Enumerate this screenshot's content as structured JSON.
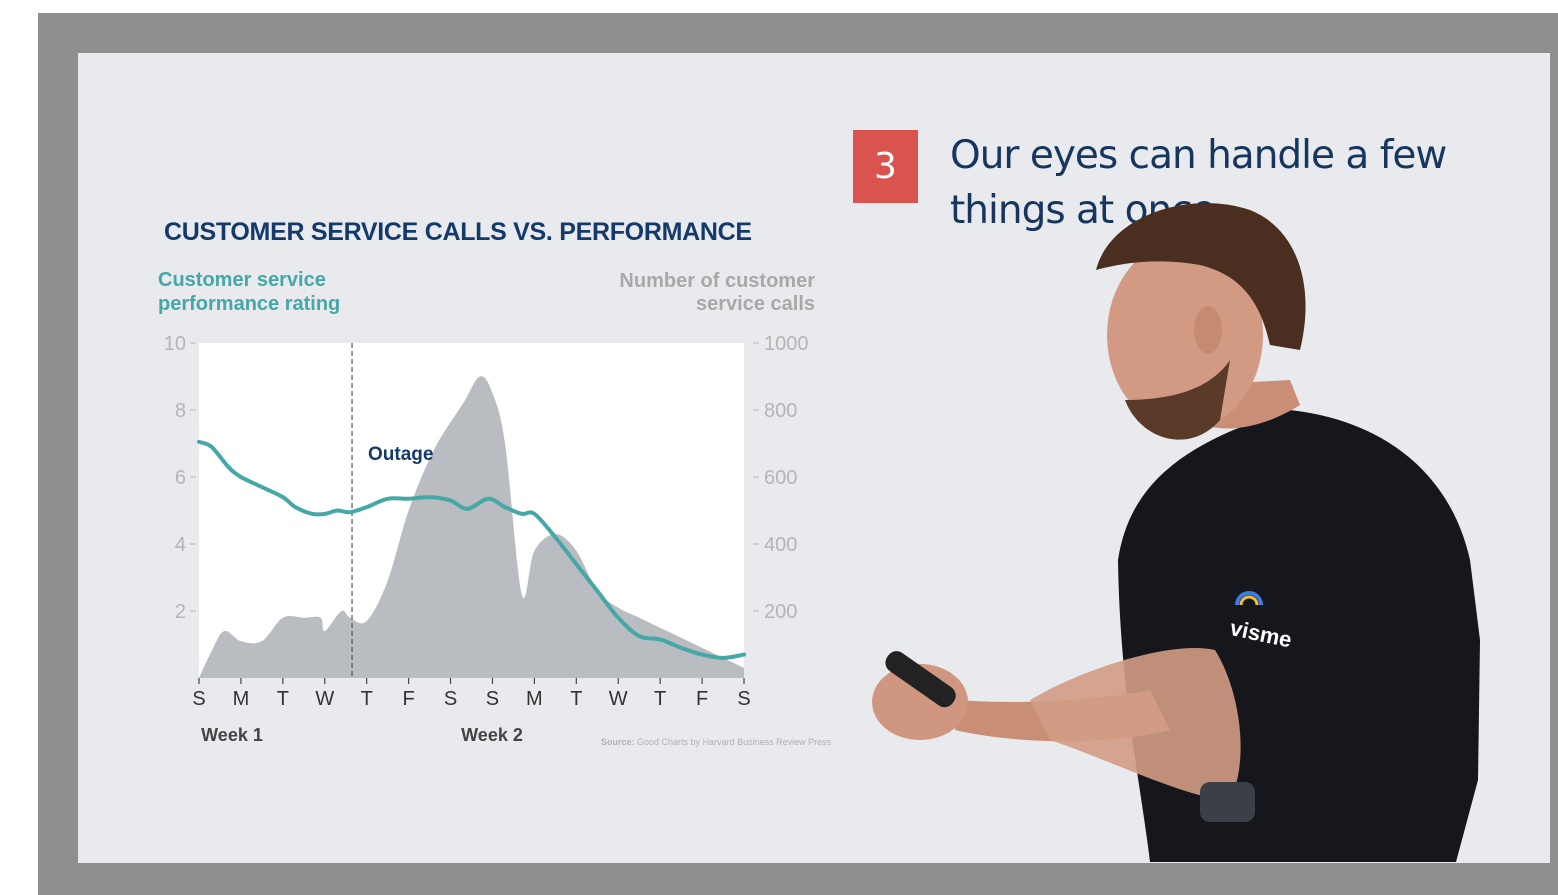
{
  "slide": {
    "step_number": "3",
    "headline": "Our eyes can handle a few things at once.",
    "shirt_logo": "visme"
  },
  "colors": {
    "frame": "#8f8f8f",
    "slide_bg": "#e8eaed",
    "badge": "#d9534f",
    "headline": "#16365f",
    "performance_line": "#45a8a6",
    "calls_area": "#b9bcc0",
    "title": "#143a6b"
  },
  "chart_data": {
    "type": "area",
    "title": "CUSTOMER SERVICE CALLS VS. PERFORMANCE",
    "ylabel_left": "Customer service performance rating",
    "ylabel_right": "Number of customer service calls",
    "categories": [
      "S",
      "M",
      "T",
      "W",
      "T",
      "F",
      "S",
      "S",
      "M",
      "T",
      "W",
      "T",
      "F",
      "S"
    ],
    "week_labels": [
      "Week 1",
      "Week 2"
    ],
    "ylim_left": [
      0,
      10
    ],
    "ylim_right": [
      0,
      1000
    ],
    "yticks_left": [
      2,
      4,
      6,
      8,
      10
    ],
    "yticks_right": [
      200,
      400,
      600,
      800,
      1000
    ],
    "annotation": {
      "label": "Outage",
      "x_index": 3.65
    },
    "series": [
      {
        "name": "Number of customer service calls",
        "axis": "right",
        "type": "area",
        "points": [
          [
            0,
            0
          ],
          [
            0.3,
            80
          ],
          [
            0.6,
            140
          ],
          [
            1,
            110
          ],
          [
            1.5,
            110
          ],
          [
            2,
            180
          ],
          [
            2.5,
            180
          ],
          [
            2.9,
            180
          ],
          [
            3,
            140
          ],
          [
            3.4,
            200
          ],
          [
            3.6,
            180
          ],
          [
            4,
            170
          ],
          [
            4.5,
            290
          ],
          [
            5,
            500
          ],
          [
            5.6,
            680
          ],
          [
            6.3,
            820
          ],
          [
            6.7,
            900
          ],
          [
            7,
            850
          ],
          [
            7.3,
            700
          ],
          [
            7.7,
            250
          ],
          [
            8,
            380
          ],
          [
            8.5,
            430
          ],
          [
            9,
            380
          ],
          [
            9.5,
            260
          ],
          [
            10,
            210
          ],
          [
            10.5,
            180
          ],
          [
            11,
            150
          ],
          [
            11.5,
            120
          ],
          [
            12,
            90
          ],
          [
            12.5,
            60
          ],
          [
            13,
            30
          ]
        ]
      },
      {
        "name": "Customer service performance rating",
        "axis": "left",
        "type": "line",
        "points": [
          [
            0,
            7.05
          ],
          [
            0.3,
            6.9
          ],
          [
            0.7,
            6.3
          ],
          [
            1,
            6
          ],
          [
            1.5,
            5.7
          ],
          [
            2,
            5.4
          ],
          [
            2.3,
            5.1
          ],
          [
            2.7,
            4.9
          ],
          [
            3,
            4.9
          ],
          [
            3.3,
            5.0
          ],
          [
            3.6,
            4.95
          ],
          [
            4,
            5.1
          ],
          [
            4.5,
            5.35
          ],
          [
            5,
            5.35
          ],
          [
            5.5,
            5.4
          ],
          [
            6,
            5.3
          ],
          [
            6.4,
            5.05
          ],
          [
            6.9,
            5.35
          ],
          [
            7.3,
            5.1
          ],
          [
            7.7,
            4.9
          ],
          [
            8,
            4.9
          ],
          [
            8.5,
            4.2
          ],
          [
            9,
            3.4
          ],
          [
            9.5,
            2.6
          ],
          [
            10,
            1.8
          ],
          [
            10.5,
            1.25
          ],
          [
            11,
            1.15
          ],
          [
            11.5,
            0.9
          ],
          [
            12,
            0.7
          ],
          [
            12.5,
            0.6
          ],
          [
            13,
            0.7
          ]
        ]
      }
    ],
    "source": {
      "label": "Source:",
      "text": "Good Charts by Harvard Business Review Press"
    }
  }
}
